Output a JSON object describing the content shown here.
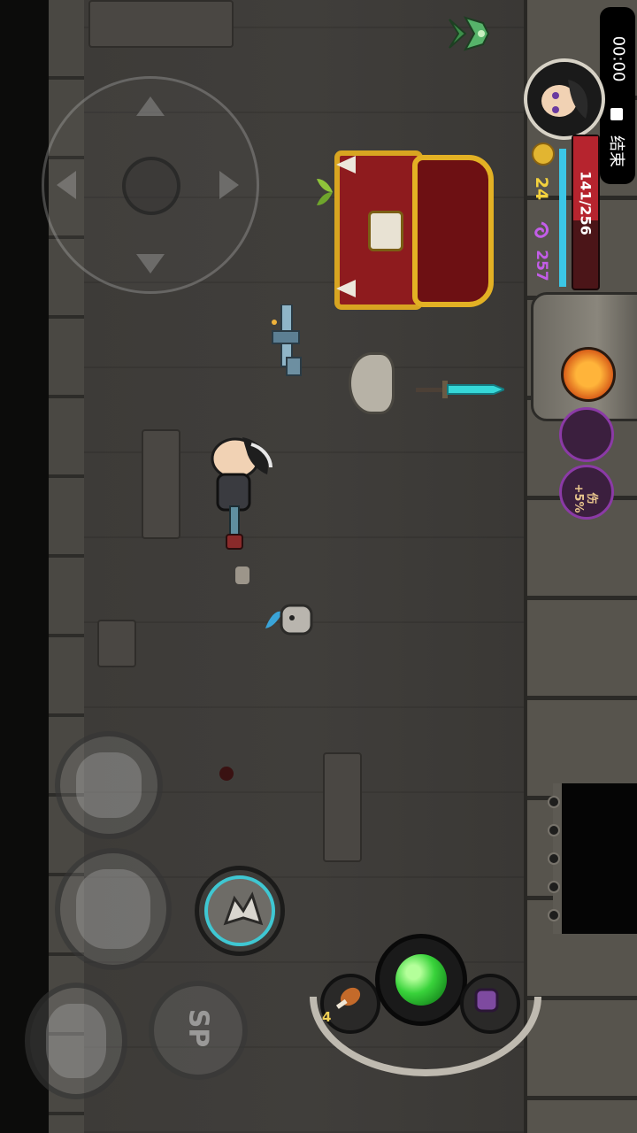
{
  "screen": {
    "orientation": "landscape-rotated",
    "theme": "dark-dungeon"
  },
  "recorder": {
    "time": "00:00",
    "end_label": "结束"
  },
  "player": {
    "hp_text": "141/256",
    "hp_current": 141,
    "hp_max": 256,
    "mana_fraction": 1.0,
    "gold": "24",
    "souls": "257"
  },
  "buffs": [
    {
      "name": "fire-rune",
      "label": ""
    },
    {
      "name": "armor-buff",
      "label": ""
    },
    {
      "name": "attack-buff",
      "label": "伤+5%"
    }
  ],
  "hotbar": {
    "food_count": "4",
    "items": [
      "food-drumstick",
      "main-orb",
      "potion"
    ]
  },
  "skills": {
    "sp_label": "SP"
  },
  "colors": {
    "hp": "#b6242e",
    "mana": "#3cc7e6",
    "gold": "#f4d23d",
    "soul": "#c35de8",
    "skill_ring": "#3fc7d2",
    "orb": "#39d33b"
  }
}
